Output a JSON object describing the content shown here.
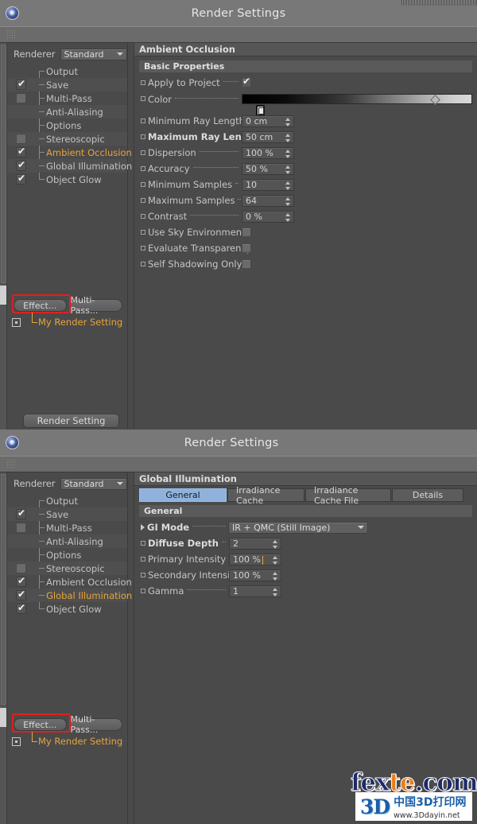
{
  "window1": {
    "title": "Render Settings",
    "renderer_label": "Renderer",
    "renderer_value": "Standard",
    "tree": [
      {
        "label": "Output",
        "check": "none",
        "selected": false
      },
      {
        "label": "Save",
        "check": "on",
        "selected": false
      },
      {
        "label": "Multi-Pass",
        "check": "off",
        "selected": false
      },
      {
        "label": "Anti-Aliasing",
        "check": "none",
        "selected": false
      },
      {
        "label": "Options",
        "check": "none",
        "selected": false
      },
      {
        "label": "Stereoscopic",
        "check": "off",
        "selected": false
      },
      {
        "label": "Ambient Occlusion",
        "check": "on",
        "selected": true
      },
      {
        "label": "Global Illumination",
        "check": "on",
        "selected": false
      },
      {
        "label": "Object Glow",
        "check": "on",
        "selected": false
      }
    ],
    "effect_button": "Effect...",
    "multipass_button": "Multi-Pass...",
    "render_setting_item": "My Render Setting",
    "bottom_button": "Render Setting",
    "panel": {
      "header": "Ambient Occlusion",
      "section": "Basic Properties",
      "rows": [
        {
          "label": "Apply to Project",
          "type": "checkbox",
          "value": "on",
          "bold": false,
          "dots": true
        },
        {
          "label": "Color",
          "type": "gradient",
          "value": "",
          "bold": false,
          "dots": true
        },
        {
          "label": "Minimum Ray Length",
          "type": "spin",
          "value": "0 cm",
          "bold": false,
          "dots": true
        },
        {
          "label": "Maximum Ray Length",
          "type": "spin",
          "value": "50 cm",
          "bold": true,
          "dots": false
        },
        {
          "label": "Dispersion",
          "type": "spin",
          "value": "100 %",
          "bold": false,
          "dots": true
        },
        {
          "label": "Accuracy",
          "type": "spin",
          "value": "50 %",
          "bold": false,
          "dots": true
        },
        {
          "label": "Minimum Samples",
          "type": "spin",
          "value": "10",
          "bold": false,
          "dots": true
        },
        {
          "label": "Maximum Samples",
          "type": "spin",
          "value": "64",
          "bold": false,
          "dots": true
        },
        {
          "label": "Contrast",
          "type": "spin",
          "value": "0 %",
          "bold": false,
          "dots": true
        },
        {
          "label": "Use Sky Environment",
          "type": "checkbox",
          "value": "off",
          "bold": false,
          "dots": false
        },
        {
          "label": "Evaluate Transparency",
          "type": "checkbox",
          "value": "off",
          "bold": false,
          "dots": false
        },
        {
          "label": "Self Shadowing Only",
          "type": "checkbox",
          "value": "off",
          "bold": false,
          "dots": false
        }
      ]
    }
  },
  "window2": {
    "title": "Render Settings",
    "renderer_label": "Renderer",
    "renderer_value": "Standard",
    "tree": [
      {
        "label": "Output",
        "check": "none",
        "selected": false
      },
      {
        "label": "Save",
        "check": "on",
        "selected": false
      },
      {
        "label": "Multi-Pass",
        "check": "off",
        "selected": false
      },
      {
        "label": "Anti-Aliasing",
        "check": "none",
        "selected": false
      },
      {
        "label": "Options",
        "check": "none",
        "selected": false
      },
      {
        "label": "Stereoscopic",
        "check": "off",
        "selected": false
      },
      {
        "label": "Ambient Occlusion",
        "check": "on",
        "selected": false
      },
      {
        "label": "Global Illumination",
        "check": "on",
        "selected": true
      },
      {
        "label": "Object Glow",
        "check": "on",
        "selected": false
      }
    ],
    "effect_button": "Effect...",
    "multipass_button": "Multi-Pass...",
    "render_setting_item": "My Render Setting",
    "panel": {
      "header": "Global Illumination",
      "tabs": [
        {
          "label": "General",
          "active": true
        },
        {
          "label": "Irradiance Cache",
          "active": false
        },
        {
          "label": "Irradiance Cache File",
          "active": false
        },
        {
          "label": "Details",
          "active": false
        }
      ],
      "section": "General",
      "rows": [
        {
          "label": "GI Mode",
          "type": "dropdown",
          "value": "IR + QMC (Still Image)",
          "bold": true,
          "dots": true
        },
        {
          "label": "Diffuse Depth",
          "type": "spin",
          "value": "2",
          "bold": true,
          "dots": true
        },
        {
          "label": "Primary Intensity",
          "type": "spin",
          "value": "100 %",
          "bold": false,
          "dots": true,
          "focused": true
        },
        {
          "label": "Secondary Intensity",
          "type": "spin",
          "value": "100 %",
          "bold": false,
          "dots": false
        },
        {
          "label": "Gamma",
          "type": "spin",
          "value": "1",
          "bold": false,
          "dots": true
        }
      ]
    }
  },
  "watermarks": {
    "fexte_part1": "fex",
    "fexte_part2": "te",
    "fexte_part3": ".com",
    "logo_3d": "3D",
    "cn_title": "中国3D打印网",
    "cn_url": "www.3Ddayin.net"
  },
  "colors": {
    "accent_selected": "#e8a33d",
    "tab_active": "#8fb2dd",
    "highlight_box": "#e02020",
    "panel_bg": "#4a4a4a",
    "titlebar_bg": "#787878"
  }
}
